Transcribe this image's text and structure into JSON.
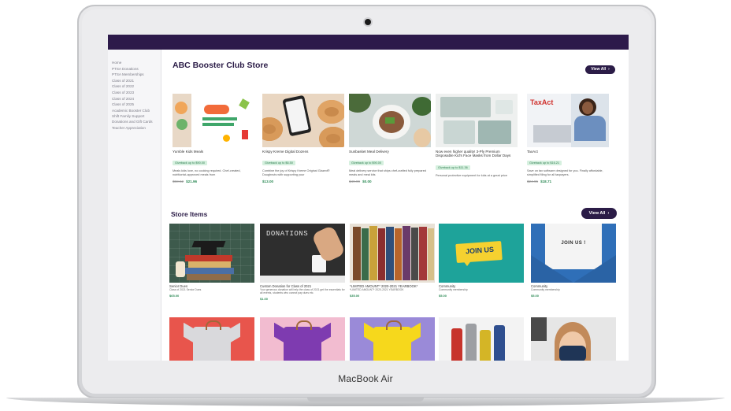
{
  "device": {
    "brand_label": "MacBook Air"
  },
  "sidebar": {
    "items": [
      {
        "label": "Home"
      },
      {
        "label": "PTSA Donations"
      },
      {
        "label": "PTSA Memberships"
      },
      {
        "label": "Class of 2021"
      },
      {
        "label": "Class of 2022"
      },
      {
        "label": "Class of 2023"
      },
      {
        "label": "Class of 2024"
      },
      {
        "label": "Class of 2025"
      },
      {
        "label": "Academic Booster Club"
      },
      {
        "label": "Shift Family Support Donations and Gift Cards"
      },
      {
        "label": "Teacher Appreciation"
      }
    ]
  },
  "store": {
    "title": "ABC Booster Club Store",
    "view_all_label": "View All",
    "view_all_arrow": "›",
    "featured": [
      {
        "name": "Yumble Kids Meals",
        "badge": "Giveback up to $90.00",
        "desc": "Meals kids love, no cooking required. Chef-created, nutritionist-approved meals from",
        "old_price": "$58.52",
        "new_price": "$21.96",
        "icon": "yumble-meals-image"
      },
      {
        "name": "Krispy Kreme Digital Dozens",
        "badge": "Giveback up to $6.50",
        "desc": "Combine the joy of Krispy Kreme Original Glazed® Doughnuts with supporting your",
        "old_price": "",
        "new_price": "$13.00",
        "icon": "donuts-image"
      },
      {
        "name": "Sunbasket Meal Delivery",
        "badge": "Giveback up to $90.00",
        "desc": "Meal delivery service that ships chef-crafted fully prepared meals and meal kits",
        "old_price": "$49.99",
        "new_price": "$0.00",
        "icon": "meal-delivery-image"
      },
      {
        "name": "Now even higher quality! 3-Ply Premium Disposable Kid's Face Masks from Dollar Days",
        "badge": "Giveback up to $11.36",
        "desc": "Personal protective equipment for kids at a great price",
        "old_price": "",
        "new_price": "",
        "icon": "face-masks-image"
      },
      {
        "name": "TaxAct",
        "badge": "Giveback up to $16.21",
        "desc": "Save on tax software designed for you. Finally affordable, simplified filing for all taxpayers.",
        "old_price": "$24.95",
        "new_price": "$18.71",
        "icon": "taxact-image",
        "logo_text": "TaxAct"
      }
    ]
  },
  "store_items": {
    "title": "Store Items",
    "view_all_label": "View All",
    "view_all_arrow": "›",
    "items": [
      {
        "name": "Senior Dues",
        "sub": "Class of 2021 Senior Dues",
        "price": "$65.00",
        "icon": "graduation-books-image"
      },
      {
        "name": "Custom Donation for Class of 2021",
        "sub": "Your generous donation will help the class of 2021 get the essentials for all events, students who cannot pay dues etc.",
        "price": "$1.00",
        "icon": "donations-jar-image",
        "sign_text": "DONATIONS"
      },
      {
        "name": "*LIMITED AMOUNT* 2020-2021 YEARBOOK*",
        "sub": "*LIMITED AMOUNT* 2020-2021 YEARBOOK",
        "price": "$35.00",
        "icon": "yearbooks-image"
      },
      {
        "name": "Community",
        "sub": "Community membership",
        "price": "$5.00",
        "icon": "join-us-sign-image",
        "sign_text": "JOIN US"
      },
      {
        "name": "Community",
        "sub": "Community membership",
        "price": "$5.00",
        "icon": "join-us-paper-image",
        "sign_text": "JOIN US !"
      }
    ],
    "row2": [
      {
        "icon": "grey-tshirt-image"
      },
      {
        "icon": "purple-tshirt-image"
      },
      {
        "icon": "yellow-tshirt-image"
      },
      {
        "icon": "water-bottles-image"
      },
      {
        "icon": "child-mask-image"
      }
    ]
  }
}
